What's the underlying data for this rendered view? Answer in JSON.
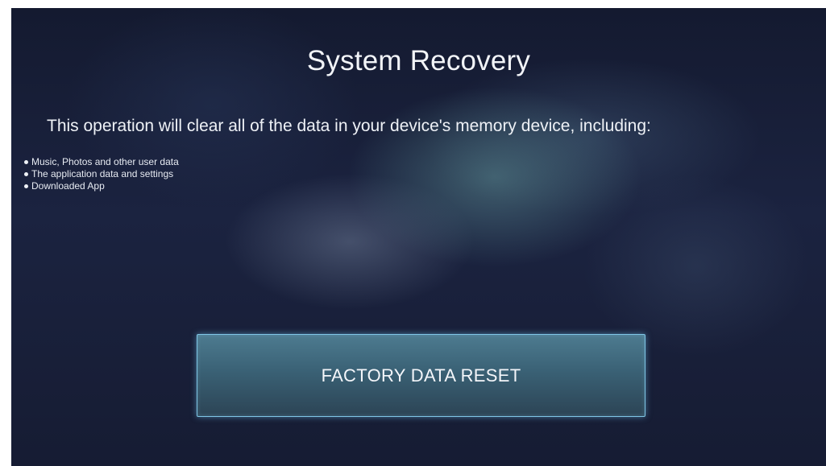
{
  "screen": {
    "title": "System Recovery",
    "description": "This operation will clear all of the data in your device's memory device, including:",
    "items": [
      "Music, Photos and other user data",
      "The application data and settings",
      "Downloaded App"
    ],
    "button_label": "FACTORY DATA RESET"
  },
  "colors": {
    "background": "#1b2340",
    "button_border": "#7fc6e6",
    "button_fill": "#3a6175",
    "text": "#f2f4f8"
  }
}
